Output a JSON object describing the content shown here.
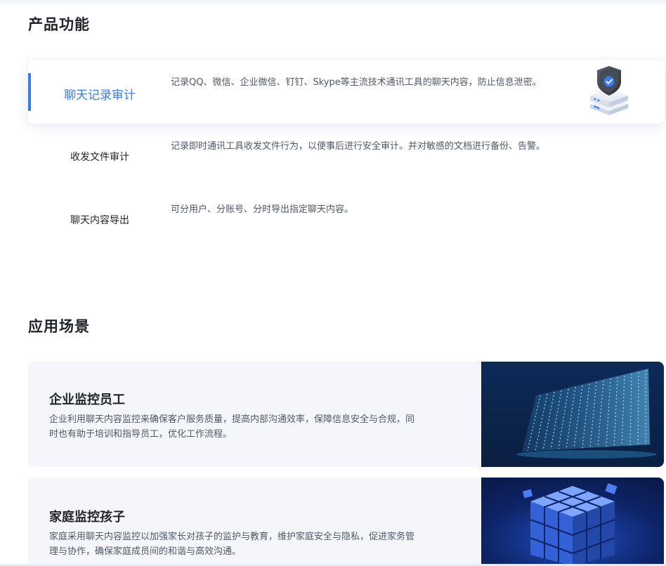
{
  "sections": {
    "features_title": "产品功能",
    "scenes_title": "应用场景"
  },
  "features": [
    {
      "name": "聊天记录审计",
      "description": "记录QQ、微信、企业微信、钉钉、Skype等主流技术通讯工具的聊天内容，防止信息泄密。",
      "active": true,
      "icon": "shield-server-icon"
    },
    {
      "name": "收发文件审计",
      "description": "记录即时通讯工具收发文件行为，以便事后进行安全审计。并对敏感的文档进行备份、告警。",
      "active": false
    },
    {
      "name": "聊天内容导出",
      "description": "可分用户、分账号、分时导出指定聊天内容。",
      "active": false
    }
  ],
  "scenes": [
    {
      "title": "企业监控员工",
      "description": "企业利用聊天内容监控来确保客户服务质量，提高内部沟通效率，保障信息安全与合规，同时也有助于培训和指导员工，优化工作流程。",
      "image": "data-stream-illustration"
    },
    {
      "title": "家庭监控孩子",
      "description": "家庭采用聊天内容监控以加强家长对孩子的监护与教育，维护家庭安全与隐私，促进家务管理与协作，确保家庭成员间的和谐与高效沟通。",
      "image": "blue-cube-illustration"
    }
  ],
  "colors": {
    "accent": "#3b7bf0",
    "card_bg": "#f4f6fb",
    "text_primary": "#1f2329",
    "text_secondary": "#505866"
  }
}
